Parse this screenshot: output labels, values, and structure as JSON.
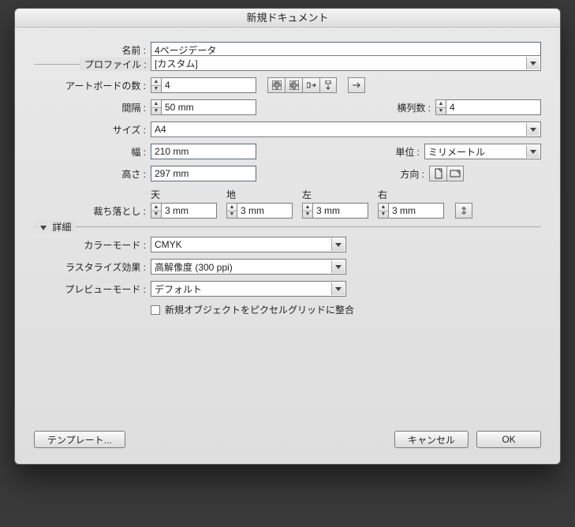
{
  "title": "新規ドキュメント",
  "labels": {
    "name": "名前 :",
    "profile": "プロファイル :",
    "artboards": "アートボードの数 :",
    "spacing": "間隔 :",
    "columns": "横列数 :",
    "size": "サイズ :",
    "width": "幅 :",
    "height": "高さ :",
    "units": "単位 :",
    "orientation": "方向 :",
    "bleed": "裁ち落とし :",
    "bleed_top": "天",
    "bleed_bottom": "地",
    "bleed_left": "左",
    "bleed_right": "右",
    "advanced": "詳細",
    "color_mode": "カラーモード :",
    "raster_effects": "ラスタライズ効果 :",
    "preview_mode": "プレビューモード :",
    "align_pixel_grid": "新規オブジェクトをピクセルグリッドに整合"
  },
  "values": {
    "name": "4ページデータ",
    "profile": "[カスタム]",
    "artboards": "4",
    "spacing": "50 mm",
    "columns": "4",
    "size": "A4",
    "width": "210 mm",
    "height": "297 mm",
    "units": "ミリメートル",
    "bleed_top": "3 mm",
    "bleed_bottom": "3 mm",
    "bleed_left": "3 mm",
    "bleed_right": "3 mm",
    "color_mode": "CMYK",
    "raster_effects": "高解像度 (300 ppi)",
    "preview_mode": "デフォルト"
  },
  "buttons": {
    "templates": "テンプレート...",
    "cancel": "キャンセル",
    "ok": "OK"
  }
}
